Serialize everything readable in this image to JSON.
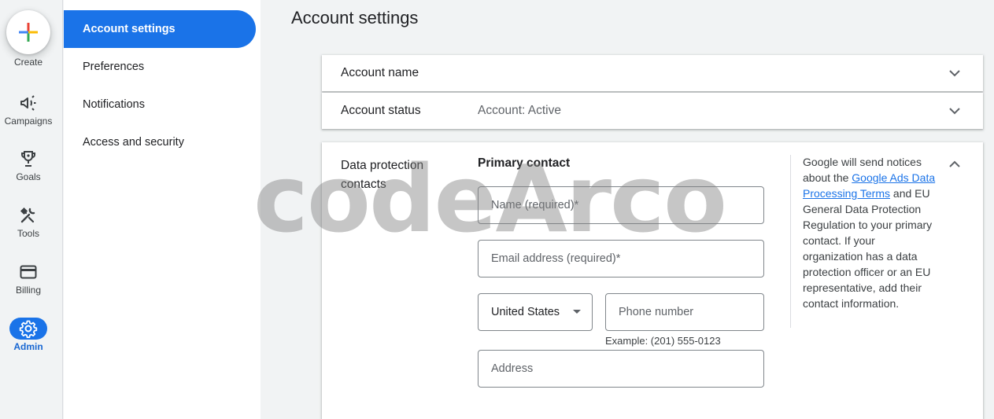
{
  "rail": {
    "create_label": "Create",
    "items": [
      {
        "label": "Campaigns",
        "icon": "megaphone-icon"
      },
      {
        "label": "Goals",
        "icon": "trophy-icon"
      },
      {
        "label": "Tools",
        "icon": "tools-icon"
      },
      {
        "label": "Billing",
        "icon": "credit-card-icon"
      },
      {
        "label": "Admin",
        "icon": "gear-icon",
        "active": true
      }
    ]
  },
  "subnav": {
    "items": [
      {
        "label": "Account settings",
        "active": true
      },
      {
        "label": "Preferences"
      },
      {
        "label": "Notifications"
      },
      {
        "label": "Access and security"
      }
    ]
  },
  "main": {
    "title": "Account settings",
    "account_name": {
      "title": "Account name"
    },
    "account_status": {
      "title": "Account status",
      "value": "Account: Active"
    },
    "data_protection": {
      "title": "Data protection contacts",
      "primary_contact": "Primary contact",
      "name_placeholder": "Name (required)*",
      "email_placeholder": "Email address (required)*",
      "country": "United States",
      "phone_placeholder": "Phone number",
      "phone_example": "Example: (201) 555-0123",
      "address_placeholder": "Address",
      "notice_before": "Google will send notices about the ",
      "notice_link": "Google Ads Data Processing Terms",
      "notice_after": " and EU General Data Protection Regulation to your primary contact. If your organization has a data protection officer or an EU representative, add their contact information."
    }
  },
  "watermark": "codeArco",
  "colors": {
    "accent": "#1a73e8",
    "background": "#f1f3f4"
  }
}
